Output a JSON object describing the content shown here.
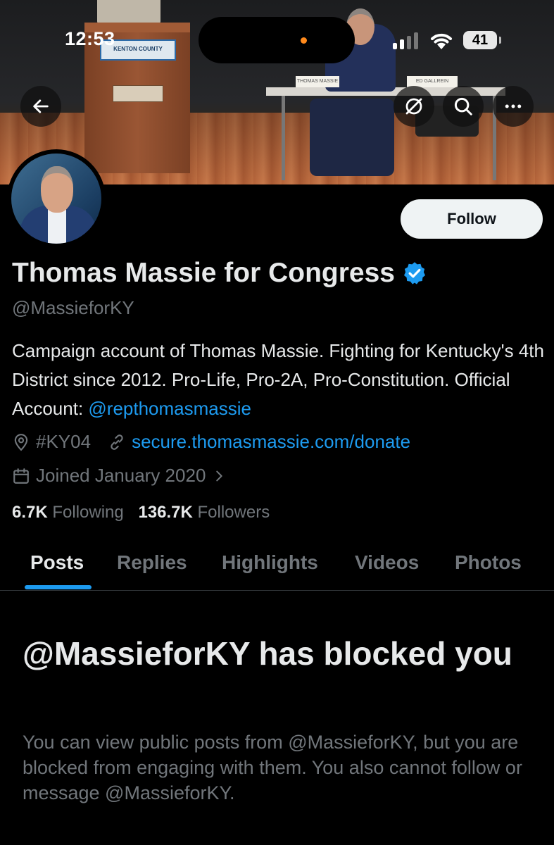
{
  "status_bar": {
    "time": "12:53",
    "battery": "41"
  },
  "banner": {
    "podium_sign": "KENTON COUNTY",
    "nameplate_left": "THOMAS MASSIE",
    "nameplate_right": "ED GALLREIN"
  },
  "nav": {
    "back_icon": "arrow-left-icon",
    "mute_icon": "bell-off-icon",
    "search_icon": "search-icon",
    "more_icon": "more-horizontal-icon"
  },
  "profile": {
    "name": "Thomas Massie for Congress",
    "handle": "@MassieforKY",
    "follow_label": "Follow",
    "bio_text": "Campaign account of Thomas Massie. Fighting for Kentucky's 4th District since 2012. Pro-Life, Pro-2A, Pro-Constitution. Official Account: ",
    "bio_mention": "@repthomasmassie",
    "location": "#KY04",
    "website": "secure.thomasmassie.com/donate",
    "joined": "Joined January 2020",
    "following_count": "6.7K",
    "following_label": "Following",
    "followers_count": "136.7K",
    "followers_label": "Followers",
    "verified_color": "#1d9bf0"
  },
  "tabs": [
    {
      "label": "Posts",
      "active": true
    },
    {
      "label": "Replies",
      "active": false
    },
    {
      "label": "Highlights",
      "active": false
    },
    {
      "label": "Videos",
      "active": false
    },
    {
      "label": "Photos",
      "active": false
    }
  ],
  "blocked": {
    "title": "@MassieforKY has blocked you",
    "description": "You can view public posts from @MassieforKY, but you are blocked from engaging with them. You also cannot follow or message @MassieforKY."
  },
  "colors": {
    "background": "#000000",
    "primary_text": "#e7e9ea",
    "secondary_text": "#71767b",
    "accent": "#1d9bf0"
  }
}
